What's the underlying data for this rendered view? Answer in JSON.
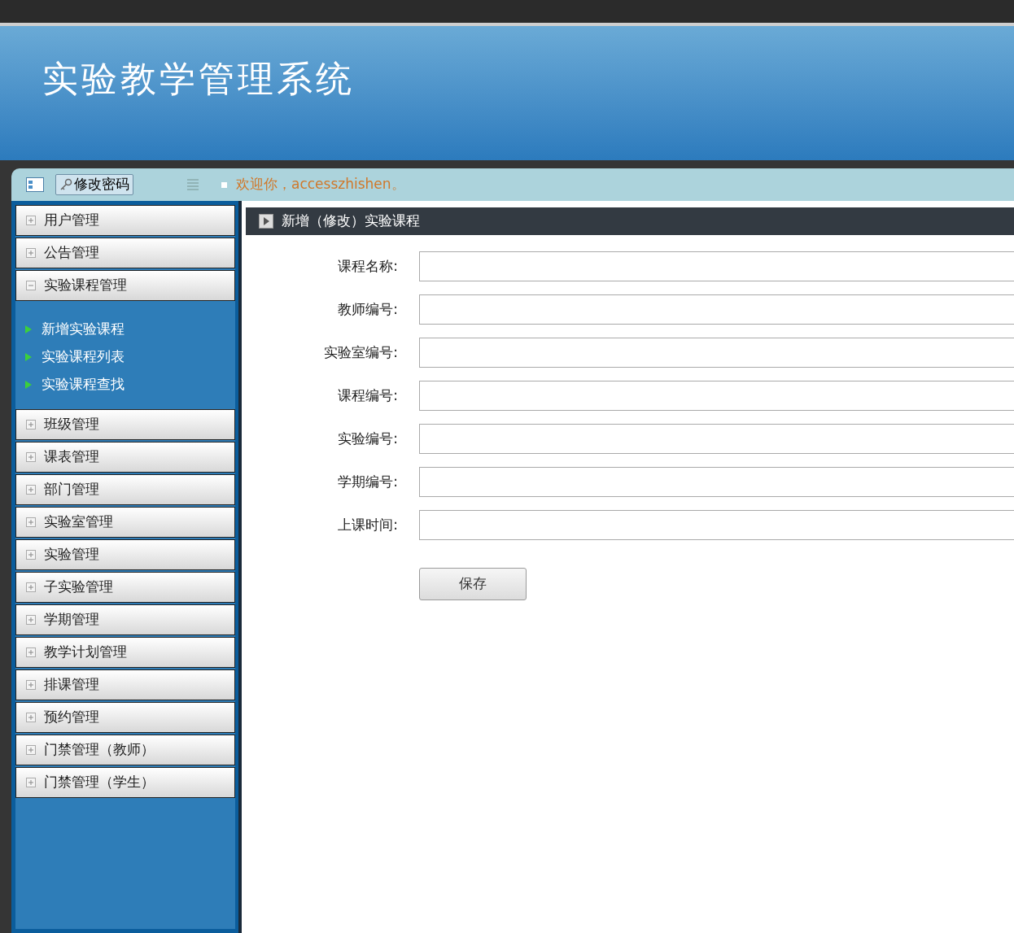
{
  "header": {
    "title": "实验教学管理系统"
  },
  "toolbar": {
    "change_password": "修改密码",
    "welcome": "欢迎你，accesszhishen。"
  },
  "sidebar": {
    "groups": [
      {
        "label": "用户管理",
        "expanded": false
      },
      {
        "label": "公告管理",
        "expanded": false
      },
      {
        "label": "实验课程管理",
        "expanded": true,
        "children": [
          {
            "label": "新增实验课程"
          },
          {
            "label": "实验课程列表"
          },
          {
            "label": "实验课程查找"
          }
        ]
      },
      {
        "label": "班级管理",
        "expanded": false
      },
      {
        "label": "课表管理",
        "expanded": false
      },
      {
        "label": "部门管理",
        "expanded": false
      },
      {
        "label": "实验室管理",
        "expanded": false
      },
      {
        "label": "实验管理",
        "expanded": false
      },
      {
        "label": "子实验管理",
        "expanded": false
      },
      {
        "label": "学期管理",
        "expanded": false
      },
      {
        "label": "教学计划管理",
        "expanded": false
      },
      {
        "label": "排课管理",
        "expanded": false
      },
      {
        "label": "预约管理",
        "expanded": false
      },
      {
        "label": "门禁管理（教师）",
        "expanded": false
      },
      {
        "label": "门禁管理（学生）",
        "expanded": false
      }
    ]
  },
  "form": {
    "title": "新增（修改）实验课程",
    "fields": [
      {
        "label": "课程名称:"
      },
      {
        "label": "教师编号:"
      },
      {
        "label": "实验室编号:"
      },
      {
        "label": "课程编号:"
      },
      {
        "label": "实验编号:"
      },
      {
        "label": "学期编号:"
      },
      {
        "label": "上课时间:"
      }
    ],
    "save_button": "保存"
  }
}
